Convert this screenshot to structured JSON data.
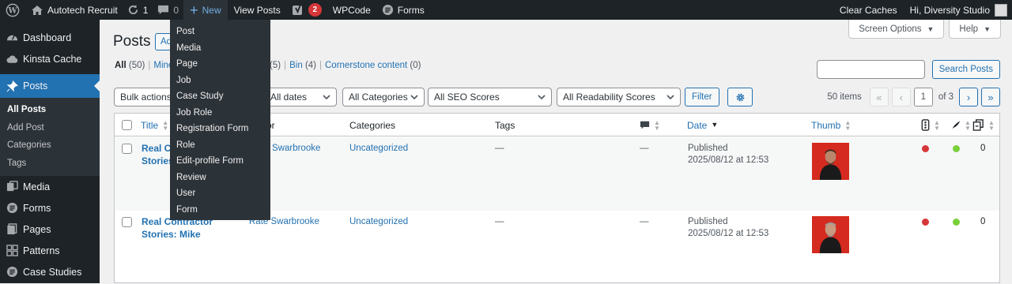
{
  "colors": {
    "adminbar": "#1d2327",
    "accent": "#2271b1",
    "badge": "#d63638",
    "seo_red": "#d63638",
    "readability_green": "#7ad03a",
    "thumb_bg": "#d52a1f"
  },
  "adminbar": {
    "site_name": "Autotech Recruit",
    "updates_count": "1",
    "comments_count": "0",
    "new_label": "New",
    "view_posts": "View Posts",
    "yoast_badge": "2",
    "wpcode": "WPCode",
    "forms": "Forms",
    "clear_caches": "Clear Caches",
    "greeting": "Hi, Diversity Studio"
  },
  "new_menu": [
    "Post",
    "Media",
    "Page",
    "Job",
    "Case Study",
    "Job Role",
    "Registration Form",
    "Role",
    "Edit-profile Form",
    "Review",
    "User",
    "Form"
  ],
  "sidebar": {
    "items": [
      {
        "label": "Dashboard",
        "icon": "dashboard-icon"
      },
      {
        "label": "Kinsta Cache",
        "icon": "cloud-icon"
      },
      {
        "label": "Posts",
        "icon": "pin-icon"
      },
      {
        "label": "Media",
        "icon": "media-icon"
      },
      {
        "label": "Forms",
        "icon": "forms-icon"
      },
      {
        "label": "Pages",
        "icon": "pages-icon"
      },
      {
        "label": "Patterns",
        "icon": "patterns-icon"
      },
      {
        "label": "Case Studies",
        "icon": "case-studies-icon"
      }
    ],
    "posts_submenu": [
      "All Posts",
      "Add Post",
      "Categories",
      "Tags"
    ]
  },
  "header": {
    "screen_options": "Screen Options",
    "help": "Help",
    "page_title": "Posts",
    "add_button": "Add"
  },
  "filters_views": {
    "all_label": "All",
    "all_count": "(50)",
    "mine_label": "Mine",
    "drafts_label": "afts",
    "drafts_count": "(5)",
    "bin_label": "Bin",
    "bin_count": "(4)",
    "cornerstone_label": "Cornerstone content",
    "cornerstone_count": "(0)"
  },
  "search": {
    "value": "",
    "button": "Search Posts"
  },
  "tablenav": {
    "bulk_actions": "Bulk actions",
    "dates": "All dates",
    "categories": "All Categories",
    "seo": "All SEO Scores",
    "readability": "All Readability Scores",
    "filter": "Filter",
    "items_count": "50 items",
    "first": "«",
    "prev": "‹",
    "current_page": "1",
    "of_pages": "of 3",
    "next": "›",
    "last": "»"
  },
  "table": {
    "columns": {
      "title": "Title",
      "author": "or",
      "categories": "Categories",
      "tags": "Tags",
      "date": "Date",
      "thumb": "Thumb"
    },
    "rows": [
      {
        "title_line1": "Real Co",
        "title_line2": "Stories",
        "author": "Swarbrooke",
        "category": "Uncategorized",
        "tags": "—",
        "comments": "—",
        "status": "Published",
        "date": "2025/08/12 at 12:53",
        "links": "0"
      },
      {
        "title_line1": "Real Contractor",
        "title_line2": "Stories: Mike",
        "author": "Rate Swarbrooke",
        "category": "Uncategorized",
        "tags": "—",
        "comments": "—",
        "status": "Published",
        "date": "2025/08/12 at 12:53",
        "links": "0"
      }
    ]
  }
}
